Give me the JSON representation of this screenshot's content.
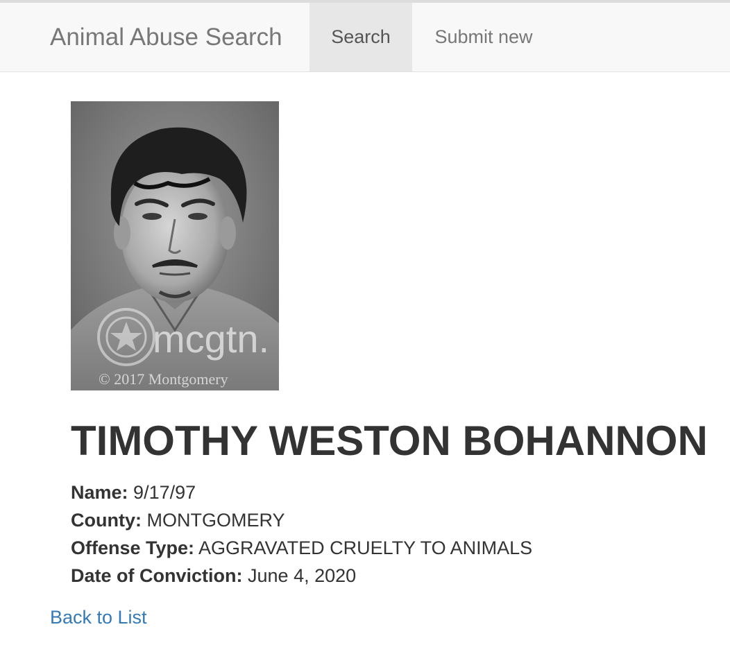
{
  "navbar": {
    "brand": "Animal Abuse Search",
    "items": [
      {
        "label": "Search",
        "active": true
      },
      {
        "label": "Submit new",
        "active": false
      }
    ]
  },
  "photo": {
    "watermark_text": "mcgtn.",
    "copyright_text": "© 2017 Montgomery"
  },
  "record": {
    "full_name": "TIMOTHY WESTON BOHANNON",
    "fields": [
      {
        "label": "Name:",
        "value": "9/17/97"
      },
      {
        "label": "County:",
        "value": "MONTGOMERY"
      },
      {
        "label": "Offense Type:",
        "value": "AGGRAVATED CRUELTY TO ANIMALS"
      },
      {
        "label": "Date of Conviction:",
        "value": "June 4, 2020"
      }
    ]
  },
  "back_link": "Back to List",
  "colors": {
    "navbar_bg": "#f8f8f8",
    "active_nav_bg": "#e7e7e7",
    "link": "#337ab7",
    "text": "#333333"
  }
}
